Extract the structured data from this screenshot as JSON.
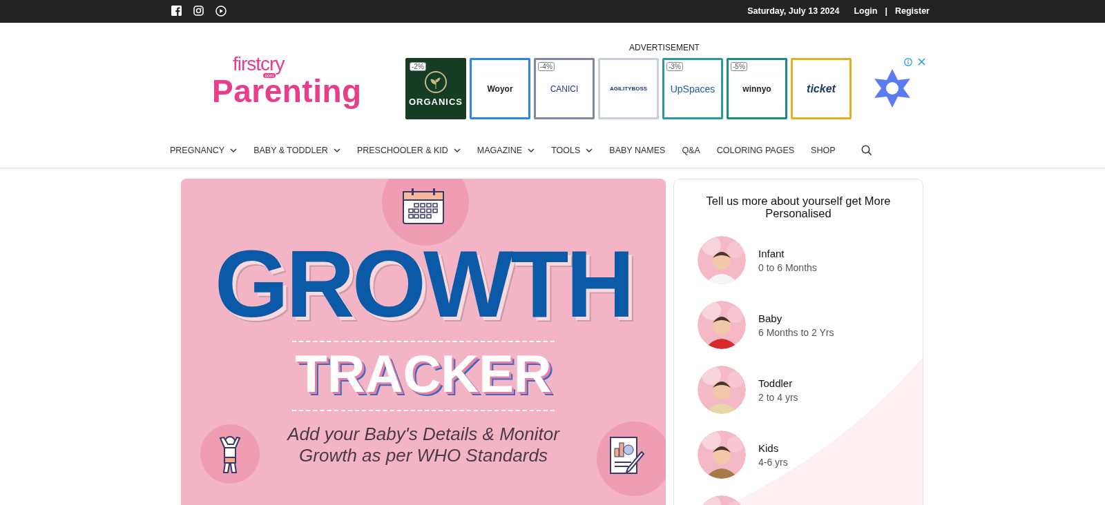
{
  "top_bar": {
    "social": [
      {
        "kind": "facebook"
      },
      {
        "kind": "instagram"
      },
      {
        "kind": "play"
      }
    ],
    "date": "Saturday, July 13 2024",
    "login": "Login",
    "separator": "|",
    "register": "Register"
  },
  "logo": {
    "top": "firstcry",
    "com": "com",
    "main": "Parenting"
  },
  "advertisement": {
    "label": "ADVERTISEMENT",
    "tiles": [
      {
        "discount": "-2%",
        "brand": "ORGANICS",
        "kind": "dark",
        "color": "#143d24"
      },
      {
        "brand": "Woyor",
        "kind": "light",
        "color": "#2f86e0"
      },
      {
        "discount": "-4%",
        "brand": "CANICI",
        "kind": "light",
        "color": "#7a86a6"
      },
      {
        "brand": "AGILITYBOSS",
        "kind": "light",
        "color": "#c9cfe0"
      },
      {
        "discount": "-3%",
        "brand": "UpSpaces",
        "kind": "light",
        "color": "#2a9a9a"
      },
      {
        "discount": "-5%",
        "brand": "winnyo",
        "kind": "light",
        "color": "#1f8a80"
      },
      {
        "brand": "ticket",
        "kind": "light",
        "color": "#e0b020"
      }
    ]
  },
  "nav": [
    {
      "label": "PREGNANCY",
      "dropdown": true
    },
    {
      "label": "BABY & TODDLER",
      "dropdown": true
    },
    {
      "label": "PRESCHOOLER & KID",
      "dropdown": true
    },
    {
      "label": "MAGAZINE",
      "dropdown": true
    },
    {
      "label": "TOOLS",
      "dropdown": true
    },
    {
      "label": "BABY NAMES",
      "dropdown": false
    },
    {
      "label": "Q&A",
      "dropdown": false
    },
    {
      "label": "COLORING PAGES",
      "dropdown": false
    },
    {
      "label": "SHOP",
      "dropdown": false
    }
  ],
  "banner": {
    "title": "GROWTH",
    "subtitle": "TRACKER",
    "text": "Add your Baby's Details & Monitor Growth as per WHO Standards"
  },
  "profile_card": {
    "title": "Tell us more about yourself get More Personalised",
    "stages": [
      {
        "name": "Infant",
        "range": "0 to 6 Months",
        "kind": "picture"
      },
      {
        "name": "Baby",
        "range": "6 Months to 2 Yrs",
        "kind": "picture"
      },
      {
        "name": "Toddler",
        "range": "2 to 4 yrs",
        "kind": "picture"
      },
      {
        "name": "Kids",
        "range": "4-6 yrs",
        "kind": "picture"
      },
      {
        "kind": "picture"
      }
    ]
  }
}
